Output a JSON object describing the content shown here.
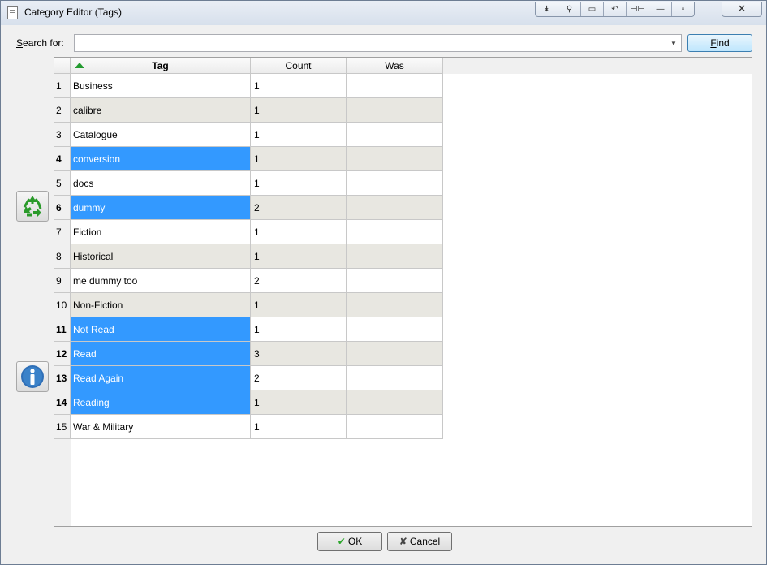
{
  "window": {
    "title": "Category Editor (Tags)",
    "titlebar_buttons": [
      "collapse-icon",
      "pin-icon",
      "restore-icon",
      "undo-icon",
      "split-icon",
      "minimize-icon",
      "maximize-icon"
    ],
    "close_label": "✕"
  },
  "search": {
    "label_accel": "S",
    "label_rest": "earch for:",
    "value": "",
    "placeholder": "",
    "find_accel": "F",
    "find_rest": "ind"
  },
  "side_buttons": [
    "recycle-icon",
    "info-icon"
  ],
  "table": {
    "sorted_column": "Tag",
    "headers": {
      "tag": "Tag",
      "count": "Count",
      "was": "Was"
    },
    "rows": [
      {
        "num": "1",
        "tag": "Business",
        "count": "1",
        "was": "",
        "selected": false
      },
      {
        "num": "2",
        "tag": "calibre",
        "count": "1",
        "was": "",
        "selected": false
      },
      {
        "num": "3",
        "tag": "Catalogue",
        "count": "1",
        "was": "",
        "selected": false
      },
      {
        "num": "4",
        "tag": "conversion",
        "count": "1",
        "was": "",
        "selected": true
      },
      {
        "num": "5",
        "tag": "docs",
        "count": "1",
        "was": "",
        "selected": false
      },
      {
        "num": "6",
        "tag": "dummy",
        "count": "2",
        "was": "",
        "selected": true
      },
      {
        "num": "7",
        "tag": "Fiction",
        "count": "1",
        "was": "",
        "selected": false
      },
      {
        "num": "8",
        "tag": "Historical",
        "count": "1",
        "was": "",
        "selected": false
      },
      {
        "num": "9",
        "tag": "me dummy too",
        "count": "2",
        "was": "",
        "selected": false
      },
      {
        "num": "10",
        "tag": "Non-Fiction",
        "count": "1",
        "was": "",
        "selected": false
      },
      {
        "num": "11",
        "tag": "Not Read",
        "count": "1",
        "was": "",
        "selected": true
      },
      {
        "num": "12",
        "tag": "Read",
        "count": "3",
        "was": "",
        "selected": true
      },
      {
        "num": "13",
        "tag": "Read Again",
        "count": "2",
        "was": "",
        "selected": true
      },
      {
        "num": "14",
        "tag": "Reading",
        "count": "1",
        "was": "",
        "selected": true
      },
      {
        "num": "15",
        "tag": "War & Military",
        "count": "1",
        "was": "",
        "selected": false
      }
    ]
  },
  "buttons": {
    "ok_accel": "O",
    "ok_rest": "K",
    "cancel_accel": "C",
    "cancel_rest": "ancel"
  },
  "colors": {
    "selection": "#3399ff",
    "alt_row": "#e8e7e1",
    "sort_arrow": "#239b2f"
  }
}
